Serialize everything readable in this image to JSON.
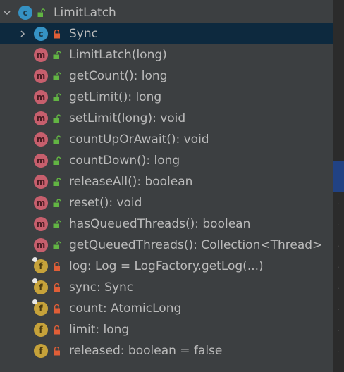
{
  "root": {
    "label": "LimitLatch",
    "kind": "c",
    "visibility": "public",
    "expanded": true
  },
  "items": [
    {
      "label": "Sync",
      "kind": "c",
      "visibility": "private",
      "expandable": true,
      "selected": true
    },
    {
      "label": "LimitLatch(long)",
      "kind": "m",
      "visibility": "public"
    },
    {
      "label": "getCount(): long",
      "kind": "m",
      "visibility": "public"
    },
    {
      "label": "getLimit(): long",
      "kind": "m",
      "visibility": "public"
    },
    {
      "label": "setLimit(long): void",
      "kind": "m",
      "visibility": "public"
    },
    {
      "label": "countUpOrAwait(): void",
      "kind": "m",
      "visibility": "public"
    },
    {
      "label": "countDown(): long",
      "kind": "m",
      "visibility": "public"
    },
    {
      "label": "releaseAll(): boolean",
      "kind": "m",
      "visibility": "public"
    },
    {
      "label": "reset(): void",
      "kind": "m",
      "visibility": "public"
    },
    {
      "label": "hasQueuedThreads(): boolean",
      "kind": "m",
      "visibility": "public"
    },
    {
      "label": "getQueuedThreads(): Collection<Thread>",
      "kind": "m",
      "visibility": "public"
    },
    {
      "label": "log: Log = LogFactory.getLog(...)",
      "kind": "f",
      "visibility": "private",
      "static": true
    },
    {
      "label": "sync: Sync",
      "kind": "f",
      "visibility": "private",
      "static": true
    },
    {
      "label": "count: AtomicLong",
      "kind": "f",
      "visibility": "private",
      "static": true
    },
    {
      "label": "limit: long",
      "kind": "f",
      "visibility": "private"
    },
    {
      "label": "released: boolean = false",
      "kind": "f",
      "visibility": "private"
    }
  ],
  "colors": {
    "panel_bg": "#3c3f41",
    "selection": "#0d293e",
    "class_icon": "#3592c4",
    "method_icon": "#c75f6d",
    "field_icon": "#c6a23a",
    "public_lock": "#62b543",
    "private_lock": "#e05e37"
  }
}
